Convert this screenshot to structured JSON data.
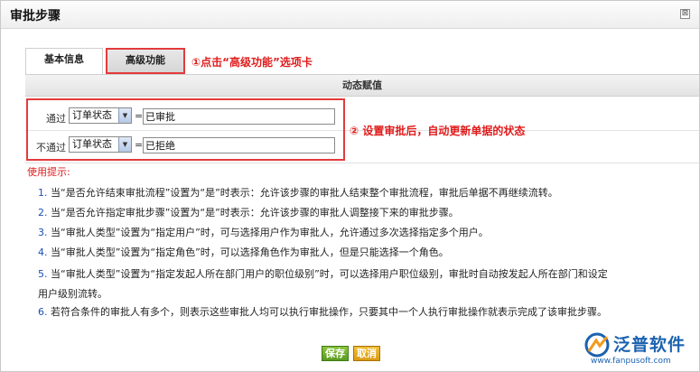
{
  "window": {
    "title": "审批步骤",
    "close_symbol": "⊠"
  },
  "tabs": [
    {
      "label": "基本信息",
      "active": false
    },
    {
      "label": "高级功能",
      "active": true
    }
  ],
  "annotations": {
    "tab_hint": "①点击“高级功能”选项卡",
    "rows_hint": "② 设置审批后，自动更新单据的状态"
  },
  "section": {
    "header": "动态赋值"
  },
  "rows": [
    {
      "label": "通过",
      "field": "订单状态",
      "operator": "=",
      "value": "已审批"
    },
    {
      "label": "不通过",
      "field": "订单状态",
      "operator": "=",
      "value": "已拒绝"
    }
  ],
  "tips": {
    "title": "使用提示:",
    "items": [
      {
        "num": "1.",
        "text": "当“是否允许结束审批流程”设置为“是”时表示：允许该步骤的审批人结束整个审批流程，审批后单据不再继续流转。"
      },
      {
        "num": "2.",
        "text": "当“是否允许指定审批步骤”设置为“是”时表示：允许该步骤的审批人调整接下来的审批步骤。"
      },
      {
        "num": "3.",
        "text": "当“审批人类型”设置为“指定用户”时，可与选择用户作为审批人，允许通过多次选择指定多个用户。"
      },
      {
        "num": "4.",
        "text": "当“审批人类型”设置为“指定角色”时，可以选择角色作为审批人，但是只能选择一个角色。"
      },
      {
        "num": "5.",
        "text": "当“审批人类型”设置为“指定发起人所在部门用户的职位级别”时，可以选择用户职位级别，审批时自动按发起人所在部门和设定用户级别流转。"
      },
      {
        "num": "6.",
        "text": "若符合条件的审批人有多个，则表示这些审批人均可以执行审批操作，只要其中一个人执行审批操作就表示完成了该审批步骤。"
      }
    ]
  },
  "buttons": {
    "save": "保存",
    "cancel": "取消"
  },
  "logo": {
    "name": "泛普软件",
    "url": "www.fanpusoft.com",
    "color": "#1c62b0"
  }
}
